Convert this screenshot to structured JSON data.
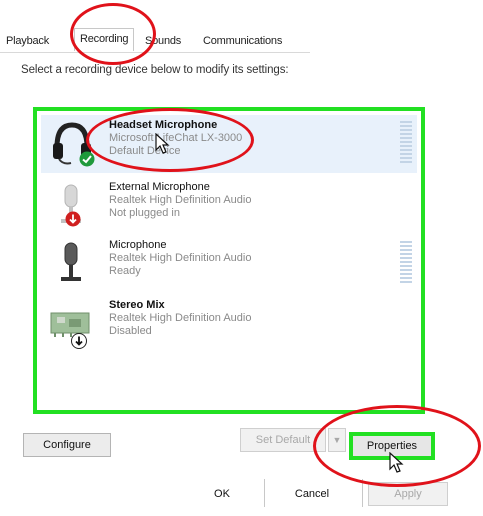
{
  "tabs": [
    {
      "label": "Playback"
    },
    {
      "label": "Recording"
    },
    {
      "label": "Sounds"
    },
    {
      "label": "Communications"
    }
  ],
  "instruction": "Select a recording device below to modify its settings:",
  "devices": [
    {
      "name": "Headset Microphone",
      "driver": "Microsoft LifeChat LX-3000",
      "status": "Default Device",
      "icon": "headset-icon",
      "badge": "default-check-icon",
      "selected": true
    },
    {
      "name": "External Microphone",
      "driver": "Realtek High Definition Audio",
      "status": "Not plugged in",
      "icon": "microphone-icon",
      "badge": "unplugged-arrow-icon",
      "selected": false
    },
    {
      "name": "Microphone",
      "driver": "Realtek High Definition Audio",
      "status": "Ready",
      "icon": "microphone-icon",
      "badge": "",
      "selected": false
    },
    {
      "name": "Stereo Mix",
      "driver": "Realtek High Definition Audio",
      "status": "Disabled",
      "icon": "circuit-board-icon",
      "badge": "disabled-arrow-icon",
      "selected": false
    }
  ],
  "buttons": {
    "configure": "Configure",
    "set_default": "Set Default",
    "properties": "Properties",
    "ok": "OK",
    "cancel": "Cancel",
    "apply": "Apply"
  },
  "colors": {
    "highlight_green": "#22e022",
    "annotation_red": "#e0121a",
    "selection_blue": "#e8f1fb"
  }
}
